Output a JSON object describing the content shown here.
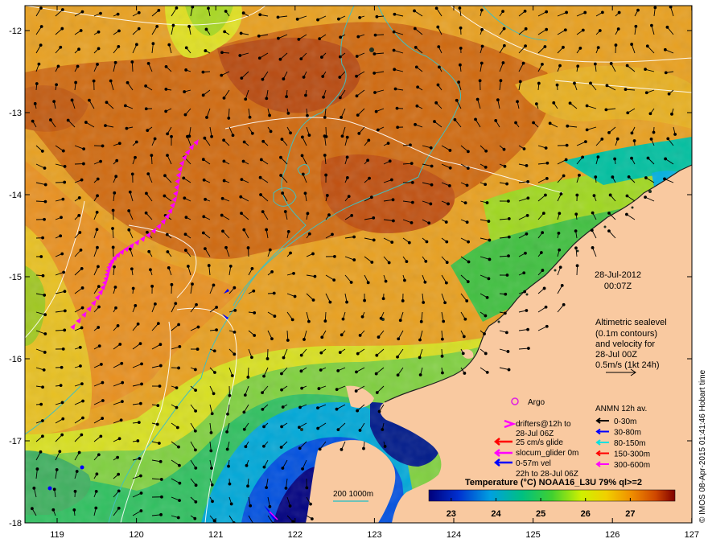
{
  "map": {
    "x_ticks": [
      "119",
      "120",
      "121",
      "122",
      "123",
      "124",
      "125",
      "126",
      "127"
    ],
    "y_ticks": [
      "-12",
      "-13",
      "-14",
      "-15",
      "-16",
      "-17",
      "-18"
    ],
    "date": "28-Jul-2012",
    "time": "00:07Z",
    "altimetry_lines": [
      "Altimetric sealevel",
      "(0.1m contours)",
      "and velocity for",
      "28-Jul 00Z",
      "0.5m/s (1kt 24h)"
    ],
    "scale_bar_label": "200  1000m",
    "credit": "© IMOS 08-Apr-2015 01:41:46 Hobart time"
  },
  "legend_left": {
    "argo": "Argo",
    "drifters_line1": "drifters@12h to",
    "drifters_line2": "28-Jul 06Z",
    "glide": "25 cm/s glide",
    "slocum": "slocum_glider 0m",
    "vel_line1": "0-57m vel",
    "vel_line2": "22h to 28-Jul 06Z",
    "colors": {
      "argo": "#e020e0",
      "drifters": "#ff00ff",
      "glide": "#ff0000",
      "slocum": "#ff00ff",
      "vel": "#0000ff"
    }
  },
  "legend_right": {
    "title": "ANMN 12h av.",
    "items": [
      {
        "label": "0-30m",
        "color": "#000000"
      },
      {
        "label": "30-80m",
        "color": "#0000ff"
      },
      {
        "label": "80-150m",
        "color": "#00e0e0"
      },
      {
        "label": "150-300m",
        "color": "#ff0000"
      },
      {
        "label": "300-600m",
        "color": "#ff00ff"
      }
    ]
  },
  "colorbar": {
    "title": "Temperature (°C) NOAA16_L3U 79% ql>=2",
    "ticks": [
      "23",
      "24",
      "25",
      "26",
      "27"
    ],
    "range": [
      22.5,
      28
    ]
  },
  "palette": {
    "land": "#f9c9a0",
    "coast_contour": "#40c0c0",
    "sea_contour": "#ffffff"
  }
}
